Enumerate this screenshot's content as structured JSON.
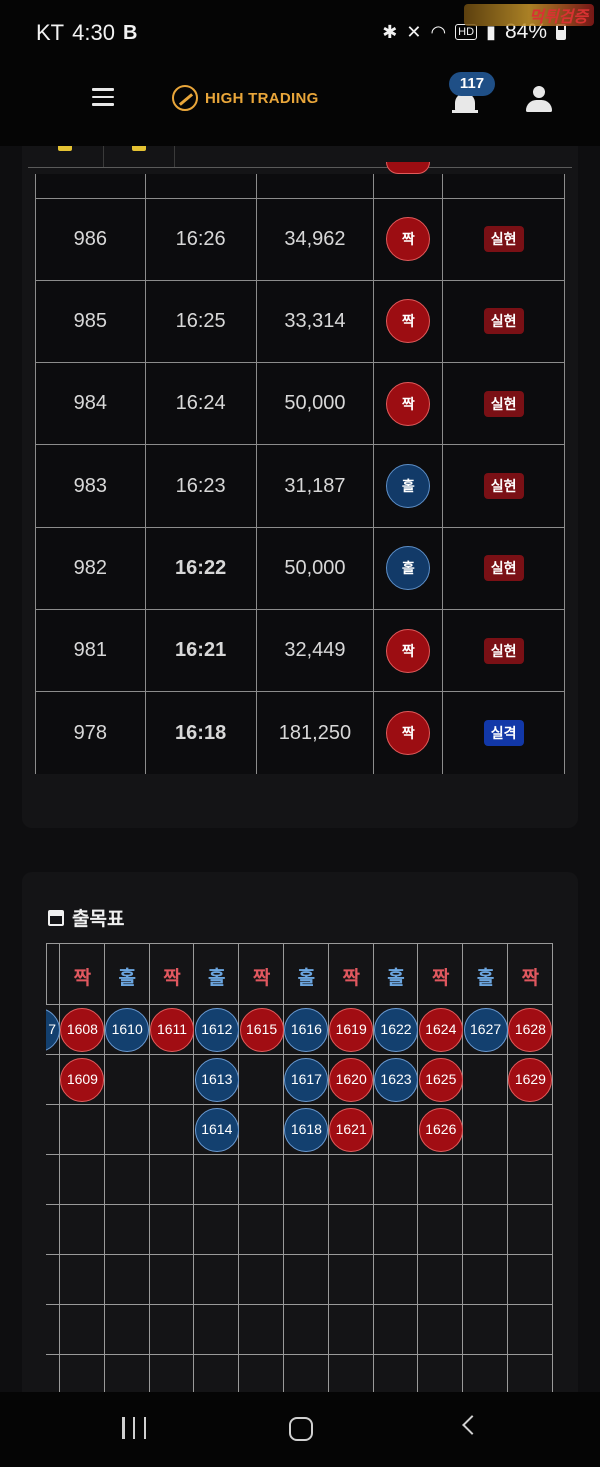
{
  "status_bar": {
    "carrier": "KT",
    "time": "4:30",
    "app_glyph": "B",
    "battery": "84%",
    "icons": [
      "bluetooth-icon",
      "vibrate-icon",
      "wifi-icon",
      "hd-icon",
      "signal-icon",
      "battery-icon"
    ],
    "hd_label": "HD",
    "watermark_text": "먹튀검증"
  },
  "app_header": {
    "brand": "HIGH TRADING",
    "brand_color": "#e9a63a",
    "notification_count": "117"
  },
  "results": {
    "rows": [
      {
        "round": "986",
        "time": "16:26",
        "amount": "34,962",
        "pick": "짝",
        "pick_color": "red",
        "status": "실현",
        "status_color": "red",
        "time_bold": false
      },
      {
        "round": "985",
        "time": "16:25",
        "amount": "33,314",
        "pick": "짝",
        "pick_color": "red",
        "status": "실현",
        "status_color": "red",
        "time_bold": false
      },
      {
        "round": "984",
        "time": "16:24",
        "amount": "50,000",
        "pick": "짝",
        "pick_color": "red",
        "status": "실현",
        "status_color": "red",
        "time_bold": false
      },
      {
        "round": "983",
        "time": "16:23",
        "amount": "31,187",
        "pick": "홀",
        "pick_color": "blue",
        "status": "실현",
        "status_color": "red",
        "time_bold": false
      },
      {
        "round": "982",
        "time": "16:22",
        "amount": "50,000",
        "pick": "홀",
        "pick_color": "blue",
        "status": "실현",
        "status_color": "red",
        "time_bold": true
      },
      {
        "round": "981",
        "time": "16:21",
        "amount": "32,449",
        "pick": "짝",
        "pick_color": "red",
        "status": "실현",
        "status_color": "red",
        "time_bold": true
      },
      {
        "round": "978",
        "time": "16:18",
        "amount": "181,250",
        "pick": "짝",
        "pick_color": "red",
        "status": "실격",
        "status_color": "blue",
        "time_bold": true
      }
    ]
  },
  "draw_board": {
    "title": "출목표",
    "columns": [
      {
        "header": "",
        "color": "blue",
        "cells": [
          "7"
        ]
      },
      {
        "header": "짝",
        "color": "red",
        "cells": [
          "1608",
          "1609"
        ]
      },
      {
        "header": "홀",
        "color": "blue",
        "cells": [
          "1610"
        ]
      },
      {
        "header": "짝",
        "color": "red",
        "cells": [
          "1611"
        ]
      },
      {
        "header": "홀",
        "color": "blue",
        "cells": [
          "1612",
          "1613",
          "1614"
        ]
      },
      {
        "header": "짝",
        "color": "red",
        "cells": [
          "1615"
        ]
      },
      {
        "header": "홀",
        "color": "blue",
        "cells": [
          "1616",
          "1617",
          "1618"
        ]
      },
      {
        "header": "짝",
        "color": "red",
        "cells": [
          "1619",
          "1620",
          "1621"
        ]
      },
      {
        "header": "홀",
        "color": "blue",
        "cells": [
          "1622",
          "1623"
        ]
      },
      {
        "header": "짝",
        "color": "red",
        "cells": [
          "1624",
          "1625",
          "1626"
        ]
      },
      {
        "header": "홀",
        "color": "blue",
        "cells": [
          "1627"
        ]
      },
      {
        "header": "짝",
        "color": "red",
        "cells": [
          "1628",
          "1629"
        ]
      }
    ],
    "colors": {
      "red": "#a10d13",
      "blue": "#13406f"
    }
  },
  "nav_bar": {
    "buttons": [
      "recent-apps-button",
      "home-button",
      "back-button"
    ]
  }
}
